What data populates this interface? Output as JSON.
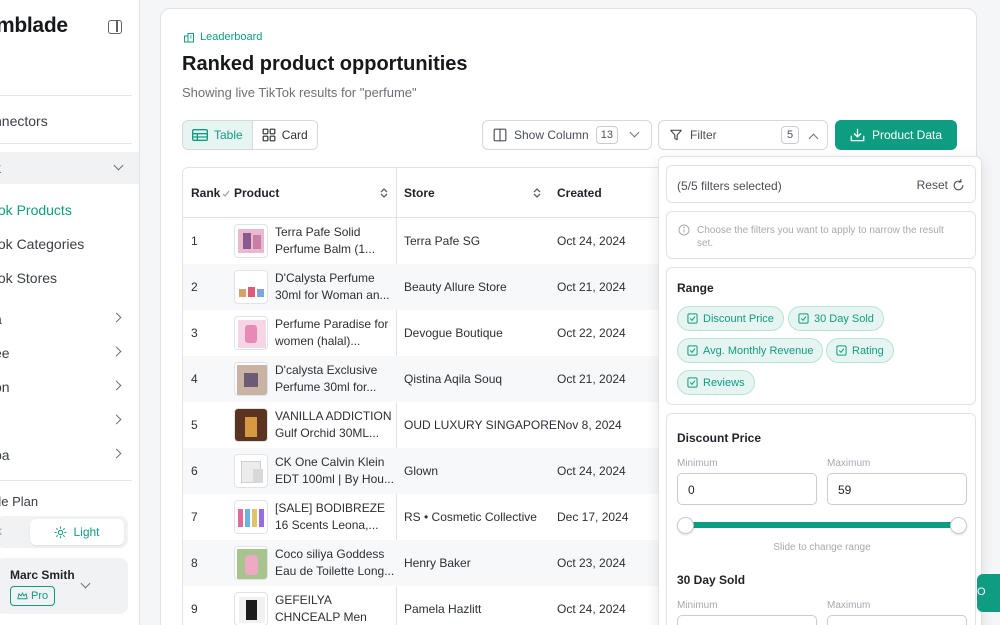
{
  "sidebar": {
    "brand": "mblade",
    "items": [
      {
        "label": "/"
      },
      {
        "label": "nnectors"
      },
      {
        "label": "k"
      }
    ],
    "subitems": [
      {
        "label": "tok Products",
        "active": true
      },
      {
        "label": "tok Categories",
        "active": false
      },
      {
        "label": "tok Stores",
        "active": false
      }
    ],
    "groups": [
      {
        "label": "a"
      },
      {
        "label": "ee"
      },
      {
        "label": "on"
      },
      {
        "label": ""
      },
      {
        "label": "pa"
      }
    ],
    "plan_label": "de Plan",
    "theme": {
      "dark": "k",
      "light": "Light"
    },
    "user": {
      "name": "Marc Smith",
      "badge": "Pro"
    }
  },
  "header": {
    "breadcrumb": "Leaderboard",
    "title": "Ranked product opportunities",
    "subtitle": "Showing live TikTok results for \"perfume\""
  },
  "toolbar": {
    "view_table": "Table",
    "view_card": "Card",
    "show_column_label": "Show Column",
    "show_column_count": "13",
    "filter_label": "Filter",
    "filter_count": "5",
    "product_data_label": "Product Data"
  },
  "table": {
    "columns": [
      "Rank",
      "Product",
      "Store",
      "Created"
    ],
    "rows": [
      {
        "rank": "1",
        "product": "Terra Pafe Solid Perfume Balm (1...",
        "store": "Terra Pafe SG",
        "created": "Oct 24, 2024"
      },
      {
        "rank": "2",
        "product": "D'Calysta Perfume 30ml for Woman an...",
        "store": "Beauty Allure Store",
        "created": "Oct 21, 2024"
      },
      {
        "rank": "3",
        "product": "Perfume Paradise for women (halal)...",
        "store": "Devogue Boutique",
        "created": "Oct 22, 2024"
      },
      {
        "rank": "4",
        "product": "D'calysta Exclusive Perfume 30ml for...",
        "store": "Qistina Aqila Souq",
        "created": "Oct 21, 2024"
      },
      {
        "rank": "5",
        "product": "VANILLA ADDICTION Gulf Orchid 30ML...",
        "store": "OUD LUXURY SINGAPORE",
        "created": "Nov 8, 2024"
      },
      {
        "rank": "6",
        "product": "CK One Calvin Klein EDT 100ml | By Hou...",
        "store": "Glown",
        "created": "Oct 24, 2024"
      },
      {
        "rank": "7",
        "product": "[SALE] BODIBREZE 16 Scents Leona,...",
        "store": "RS • Cosmetic Collective",
        "created": "Dec 17, 2024"
      },
      {
        "rank": "8",
        "product": "Coco siliya Goddess Eau de Toilette Long...",
        "store": "Henry Baker",
        "created": "Oct 23, 2024"
      },
      {
        "rank": "9",
        "product": "GEFEILYA CHNCEALP Men Long-Lasting...",
        "store": "Pamela Hazlitt",
        "created": "Oct 24, 2024"
      }
    ]
  },
  "filter_panel": {
    "selected_text": "(5/5 filters selected)",
    "reset_label": "Reset",
    "hint": "Choose the filters you want to apply to narrow the result set.",
    "range_title": "Range",
    "chips": [
      "Discount Price",
      "30 Day Sold",
      "Avg. Monthly Revenue",
      "Rating",
      "Reviews"
    ],
    "discount_price": {
      "title": "Discount Price",
      "min_label": "Minimum",
      "max_label": "Maximum",
      "min_value": "0",
      "max_value": "59",
      "slider_hint": "Slide to change range"
    },
    "sold_30": {
      "title": "30 Day Sold",
      "min_label": "Minimum",
      "max_label": "Maximum"
    }
  },
  "float_button": "O",
  "colors": {
    "accent": "#0f9d82",
    "accent_soft": "#e6f5f1",
    "border": "#dfe2e6"
  }
}
